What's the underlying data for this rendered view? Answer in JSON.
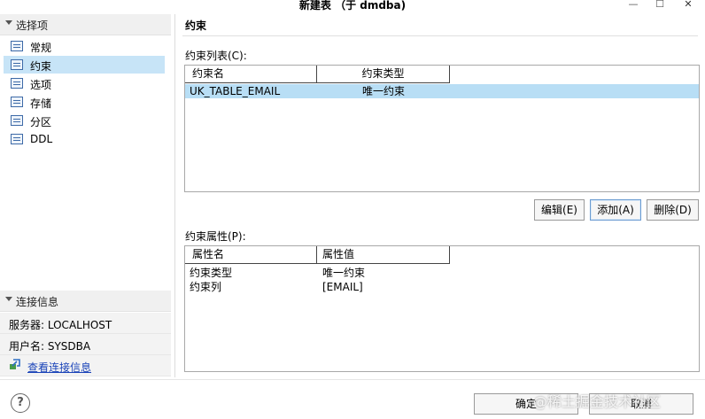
{
  "window": {
    "title": "新建表 （于 dmdba)",
    "min_glyph": "—",
    "max_glyph": "☐",
    "close_glyph": "✕"
  },
  "sidebar": {
    "section_title": "选择项",
    "items": [
      {
        "label": "常规",
        "selected": false
      },
      {
        "label": "约束",
        "selected": true
      },
      {
        "label": "选项",
        "selected": false
      },
      {
        "label": "存储",
        "selected": false
      },
      {
        "label": "分区",
        "selected": false
      },
      {
        "label": "DDL",
        "selected": false
      }
    ],
    "connection_title": "连接信息",
    "server": "服务器: LOCALHOST",
    "user": "用户名: SYSDBA",
    "view_link": "查看连接信息"
  },
  "main": {
    "heading": "约束",
    "constraints_label": "约束列表(C):",
    "constraints_columns": [
      "约束名",
      "约束类型"
    ],
    "constraints_rows": [
      {
        "name": "UK_TABLE_EMAIL",
        "type": "唯一约束"
      }
    ],
    "buttons": {
      "edit": "编辑(E)",
      "add": "添加(A)",
      "delete": "删除(D)"
    },
    "properties_label": "约束属性(P):",
    "properties_columns": [
      "属性名",
      "属性值"
    ],
    "properties_rows": [
      {
        "name": "约束类型",
        "value": "唯一约束"
      },
      {
        "name": "约束列",
        "value": "[EMAIL]"
      }
    ]
  },
  "footer": {
    "help_glyph": "?",
    "ok": "确定",
    "cancel": "取消",
    "watermark": "@稀土掘金技术社区"
  }
}
